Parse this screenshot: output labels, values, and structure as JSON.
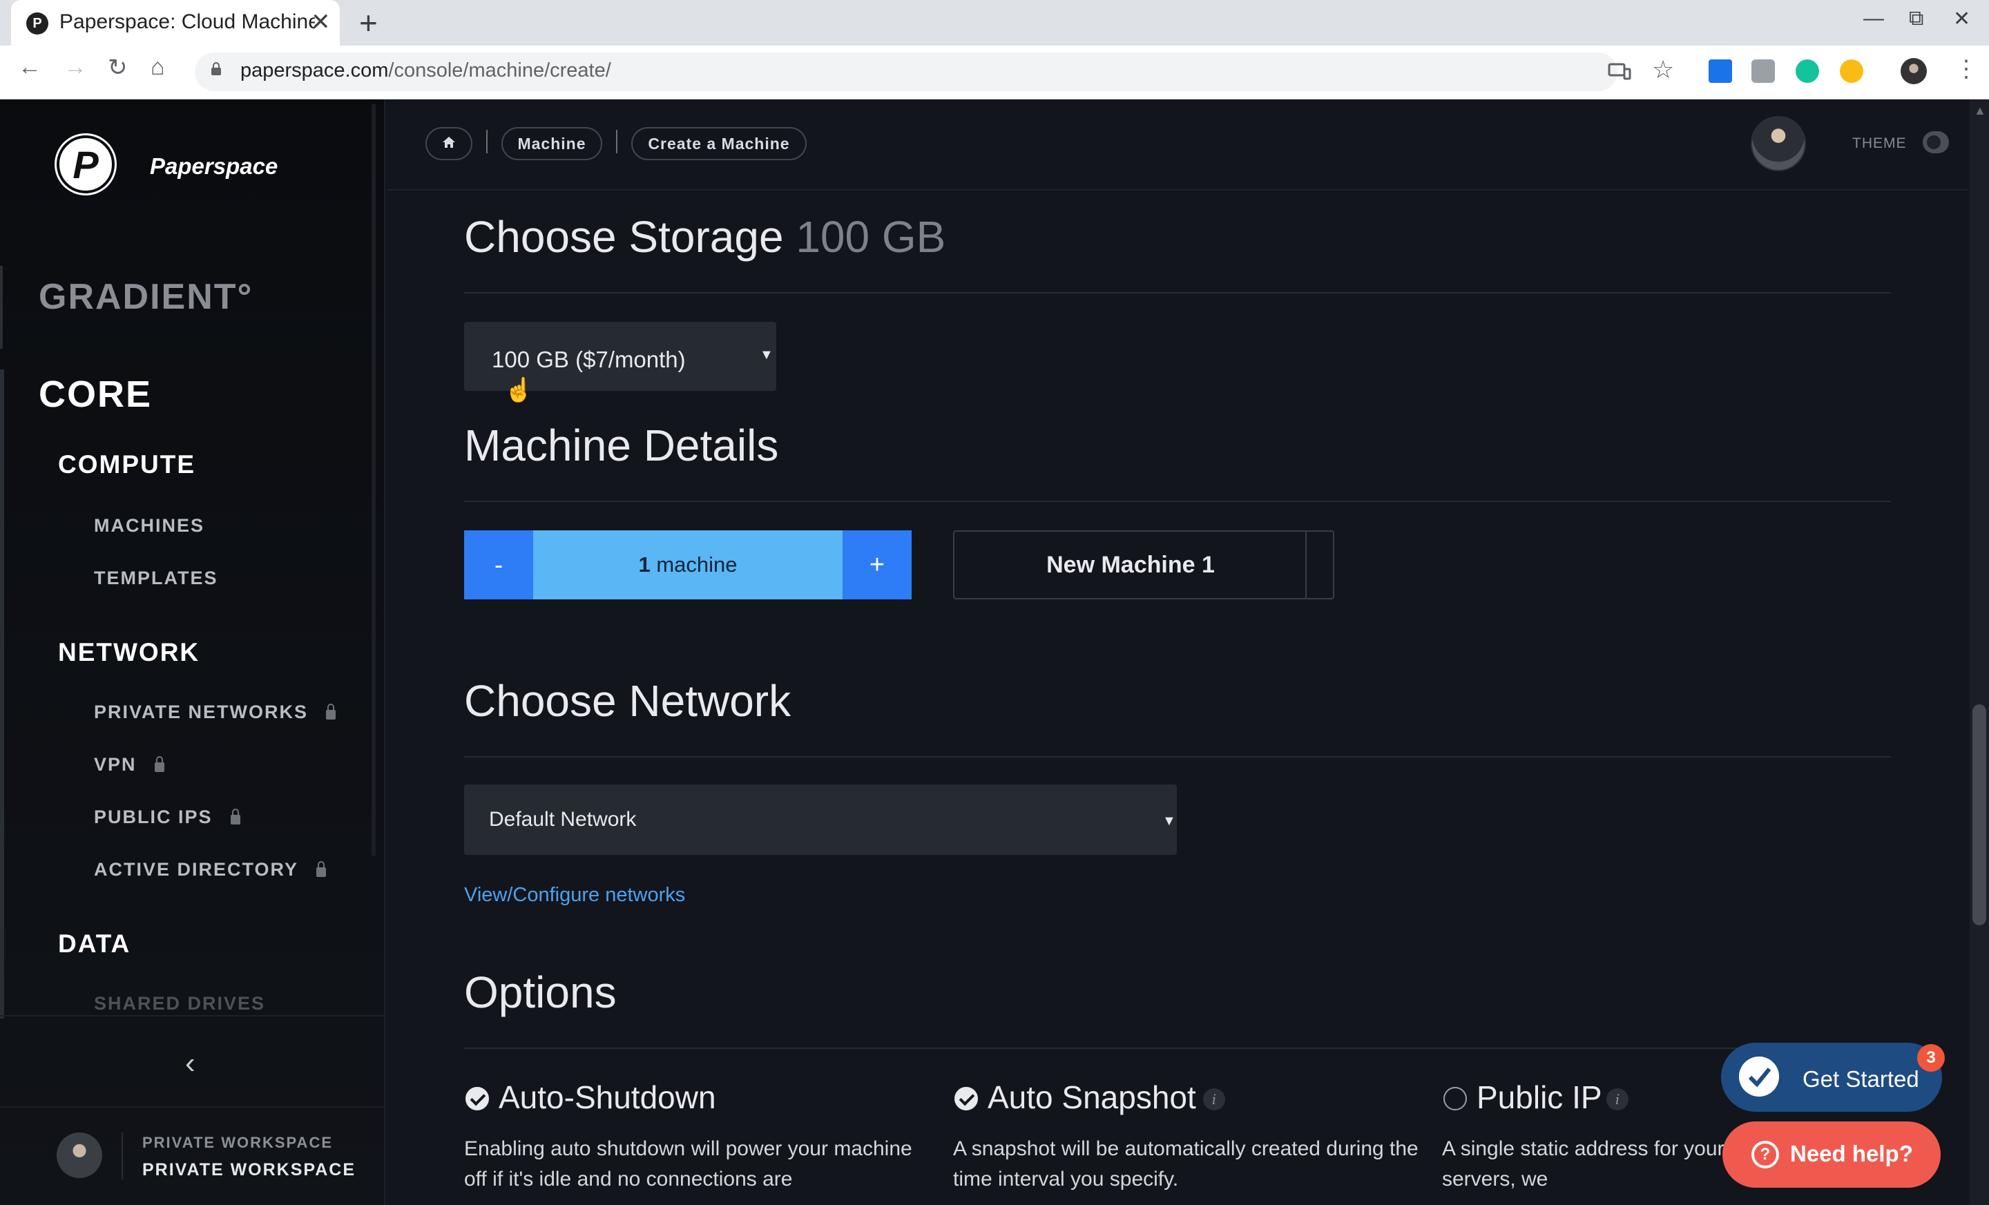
{
  "browser": {
    "tab_title": "Paperspace: Cloud Machine",
    "new_tab": "+",
    "close": "✕",
    "url_domain": "paperspace.com",
    "url_path": "/console/machine/create/",
    "min": "—",
    "restore": "⧉",
    "win_close": "✕"
  },
  "sidebar": {
    "brand": "Paperspace",
    "logo_letter": "P",
    "gradient": "GRADIENT°",
    "core": "CORE",
    "compute": "COMPUTE",
    "machines": "MACHINES",
    "templates": "TEMPLATES",
    "network": "NETWORK",
    "private_networks": "PRIVATE NETWORKS",
    "vpn": "VPN",
    "public_ips": "PUBLIC IPS",
    "active_directory": "ACTIVE DIRECTORY",
    "data": "DATA",
    "shared_drives": "SHARED DRIVES",
    "collapse": "‹",
    "workspace_top": "PRIVATE WORKSPACE",
    "workspace_bottom": "PRIVATE WORKSPACE"
  },
  "header": {
    "crumb_machine": "Machine",
    "crumb_create": "Create a Machine",
    "theme_label": "THEME"
  },
  "storage": {
    "title": "Choose Storage",
    "size": "100 GB",
    "selected": "100 GB  ($7/month)"
  },
  "details": {
    "title": "Machine Details",
    "minus": "-",
    "plus": "+",
    "count": "1",
    "unit": "machine",
    "machine_name": "New Machine 1"
  },
  "network": {
    "title": "Choose Network",
    "selected": "Default Network",
    "link": "View/Configure networks"
  },
  "options": {
    "title": "Options",
    "auto_shutdown": {
      "title": "Auto-Shutdown",
      "desc": "Enabling auto shutdown will power your machine off if it's idle and no connections are",
      "checked": true
    },
    "auto_snapshot": {
      "title": "Auto Snapshot",
      "desc": "A snapshot will be automatically created during the time interval you specify.",
      "checked": true
    },
    "public_ip": {
      "title": "Public IP",
      "desc": "A single static address for your machine. Perfect for servers, we",
      "checked": false
    },
    "info": "i"
  },
  "widgets": {
    "get_started": "Get Started",
    "badge": "3",
    "need_help": "Need help?",
    "help_icon": "?"
  },
  "colors": {
    "accent_blue": "#2e7cf6",
    "stepper_fill": "#5ab6f4",
    "link": "#4aa3f0",
    "help": "#f05a4e"
  }
}
